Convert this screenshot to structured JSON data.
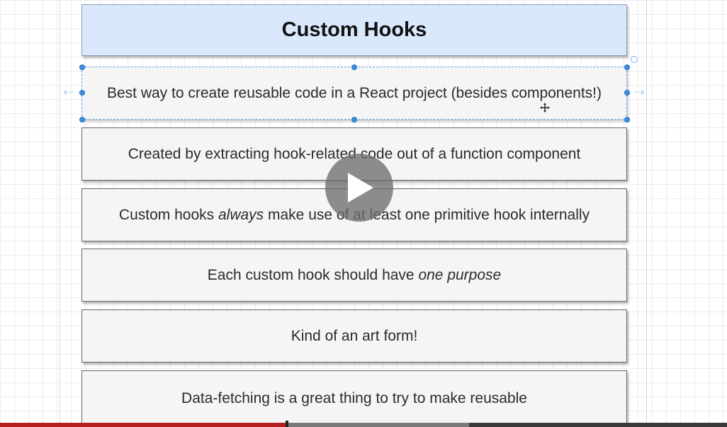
{
  "slide": {
    "title": "Custom Hooks",
    "cards": [
      {
        "text": "Best way to create reusable code in a React project (besides components!)",
        "selected": true
      },
      {
        "text": "Created by extracting hook-related code out of a function component"
      },
      {
        "before": "Custom hooks ",
        "emphasis": "always",
        "after": " make use of at least one primitive hook internally"
      },
      {
        "before": "Each custom hook should have ",
        "emphasis": "one purpose",
        "after": ""
      },
      {
        "text": "Kind of an art form!"
      },
      {
        "text": "Data-fetching is a great thing to try to make reusable"
      }
    ]
  },
  "player": {
    "play_icon": "play-icon",
    "progress_played_fraction": 0.395,
    "progress_buffered_fraction": 0.645
  },
  "colors": {
    "title_fill": "#dae8fc",
    "card_fill": "#f5f5f5",
    "selection": "#3a8ee6",
    "progress_played": "#b51f1f"
  }
}
